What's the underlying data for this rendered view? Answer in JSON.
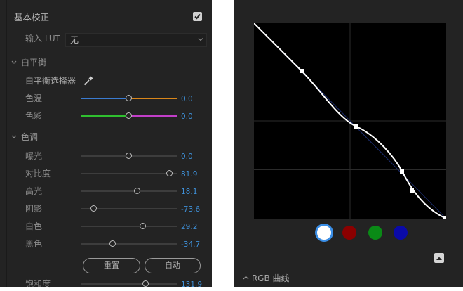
{
  "basic": {
    "title": "基本校正",
    "lut_label": "输入 LUT",
    "lut_value": "无",
    "wb_section": "白平衡",
    "wb_selector": "白平衡选择器",
    "temp_label": "色温",
    "temp_value": "0.0",
    "tint_label": "色彩",
    "tint_value": "0.0",
    "tone_section": "色调",
    "reset_label": "重置",
    "auto_label": "自动"
  },
  "sliders": [
    {
      "label": "曝光",
      "value": "0.0",
      "pos": 0.5
    },
    {
      "label": "对比度",
      "value": "81.9",
      "pos": 0.93
    },
    {
      "label": "高光",
      "value": "18.1",
      "pos": 0.59
    },
    {
      "label": "阴影",
      "value": "-73.6",
      "pos": 0.13
    },
    {
      "label": "白色",
      "value": "29.2",
      "pos": 0.65
    },
    {
      "label": "黑色",
      "value": "-34.7",
      "pos": 0.33
    }
  ],
  "saturation": {
    "label": "饱和度",
    "value": "131.9",
    "pos": 0.68
  },
  "rgb": {
    "label": "RGB 曲线",
    "channels": [
      "white",
      "red",
      "green",
      "blue"
    ],
    "colors": {
      "white": "#ffffff",
      "red": "#8b0000",
      "green": "#0a8a16",
      "blue": "#0a0aa8"
    }
  },
  "colors": {
    "accent": "#3e8fd6",
    "panel": "#232323"
  }
}
